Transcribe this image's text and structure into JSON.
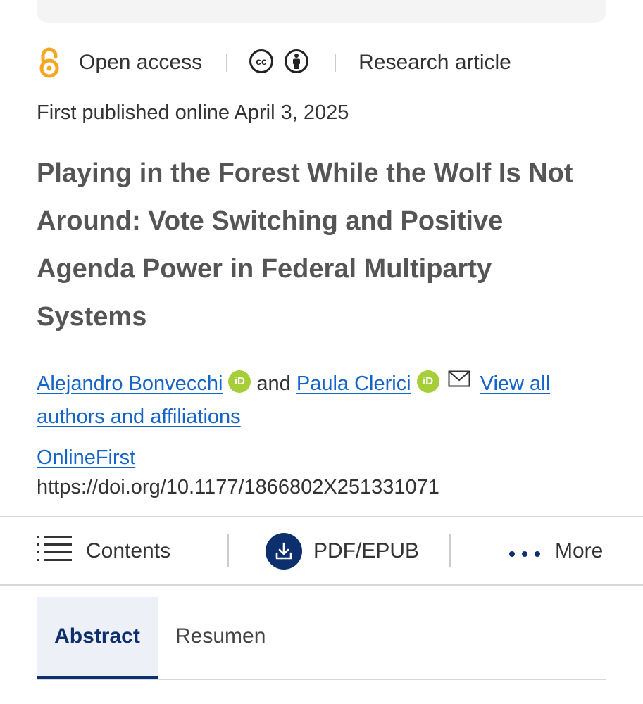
{
  "meta": {
    "open_access_label": "Open access",
    "license_icons": [
      "cc-icon",
      "by-attribution-icon"
    ],
    "article_type": "Research article",
    "colors": {
      "open_access": "#f5a623",
      "link": "#1565c8",
      "orcid": "#a6ce39",
      "brand": "#0e2f6e"
    }
  },
  "published": "First published online April 3, 2025",
  "title": "Playing in the Forest While the Wolf Is Not Around: Vote Switching and Positive Agenda Power in Federal Multiparty Systems",
  "authors": {
    "author1": "Alejandro Bonvecchi",
    "connector": "and",
    "author2": "Paula Clerici",
    "orcid_label": "iD",
    "view_all": "View all authors and affiliations"
  },
  "issue_label": "OnlineFirst",
  "doi": "https://doi.org/10.1177/1866802X251331071",
  "toolbar": {
    "contents": "Contents",
    "pdf": "PDF/EPUB",
    "more": "More"
  },
  "tabs": [
    {
      "label": "Abstract",
      "active": true
    },
    {
      "label": "Resumen",
      "active": false
    }
  ]
}
